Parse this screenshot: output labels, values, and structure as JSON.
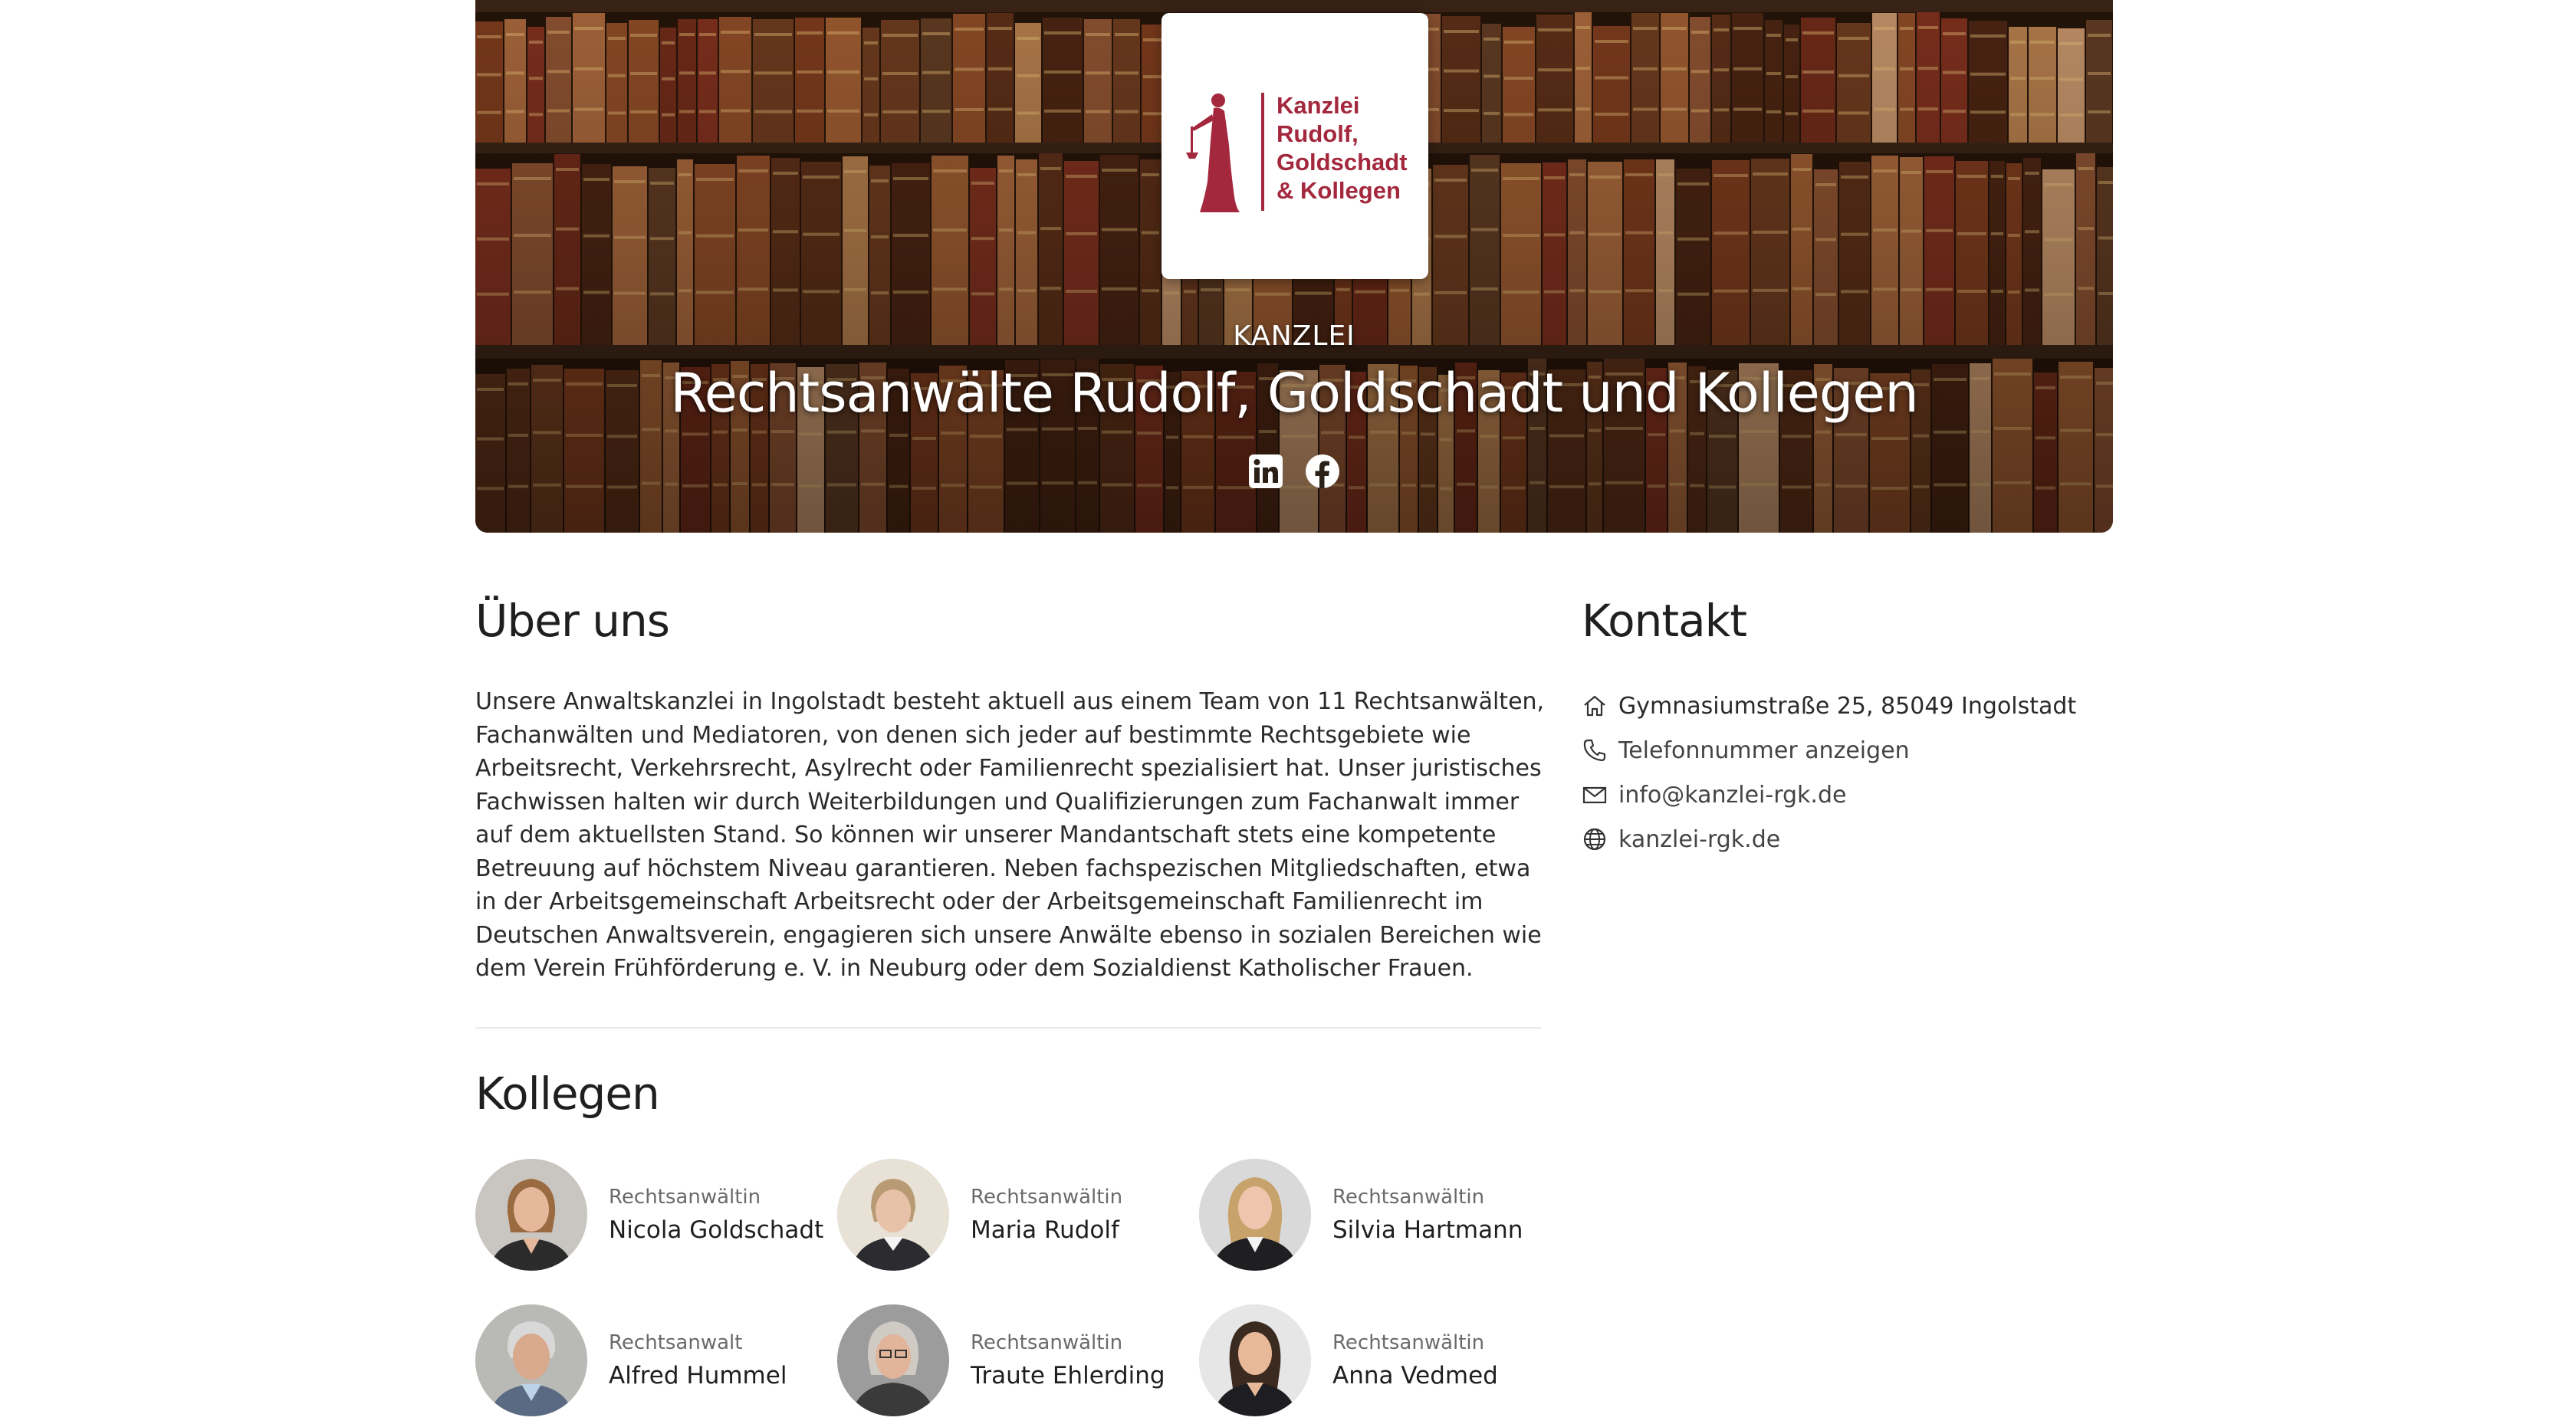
{
  "hero": {
    "logo_lines": [
      "Kanzlei",
      "Rudolf,",
      "Goldschadt",
      "& Kollegen"
    ],
    "kicker": "KANZLEI",
    "title": "Rechtsanwälte Rudolf, Goldschadt und Kollegen",
    "socials": [
      {
        "icon": "linkedin-icon"
      },
      {
        "icon": "facebook-icon"
      }
    ]
  },
  "about": {
    "heading": "Über uns",
    "text": "Unsere Anwaltskanzlei in Ingolstadt besteht aktuell aus einem Team von 11 Rechtsanwälten, Fachanwälten und Mediatoren, von denen sich jeder auf bestimmte Rechtsgebiete wie Arbeitsrecht, Verkehrsrecht, Asylrecht oder Familienrecht spezialisiert hat. Unser juristisches Fachwissen halten wir durch Weiterbildungen und Qualifizierungen zum Fachanwalt immer auf dem aktuellsten Stand. So können wir unserer Mandantschaft stets eine kompetente Betreuung auf höchstem Niveau garantieren. Neben fachspezischen Mitgliedschaften, etwa in der Arbeitsgemeinschaft Arbeitsrecht oder der Arbeitsgemeinschaft Familienrecht im Deutschen Anwaltsverein, engagieren sich unsere Anwälte ebenso in sozialen Bereichen wie dem Verein Frühförderung e. V. in Neuburg oder dem Sozialdienst Katholischer Frauen."
  },
  "contact": {
    "heading": "Kontakt",
    "address": "Gymnasiumstraße 25, 85049 Ingolstadt",
    "phone": "Telefonnummer anzeigen",
    "email": "info@kanzlei-rgk.de",
    "website": "kanzlei-rgk.de",
    "icons": [
      "home-icon",
      "phone-icon",
      "mail-icon",
      "globe-icon"
    ]
  },
  "team": {
    "heading": "Kollegen",
    "members": [
      {
        "role": "Rechtsanwältin",
        "name": "Nicola Goldschadt"
      },
      {
        "role": "Rechtsanwältin",
        "name": "Maria Rudolf"
      },
      {
        "role": "Rechtsanwältin",
        "name": "Silvia Hartmann"
      },
      {
        "role": "Rechtsanwalt",
        "name": "Alfred Hummel"
      },
      {
        "role": "Rechtsanwältin",
        "name": "Traute Ehlerding"
      },
      {
        "role": "Rechtsanwältin",
        "name": "Anna Vedmed"
      }
    ]
  },
  "colors": {
    "brand": "#a3283d",
    "text": "#1f1f1f",
    "muted": "#6a6a6a"
  }
}
